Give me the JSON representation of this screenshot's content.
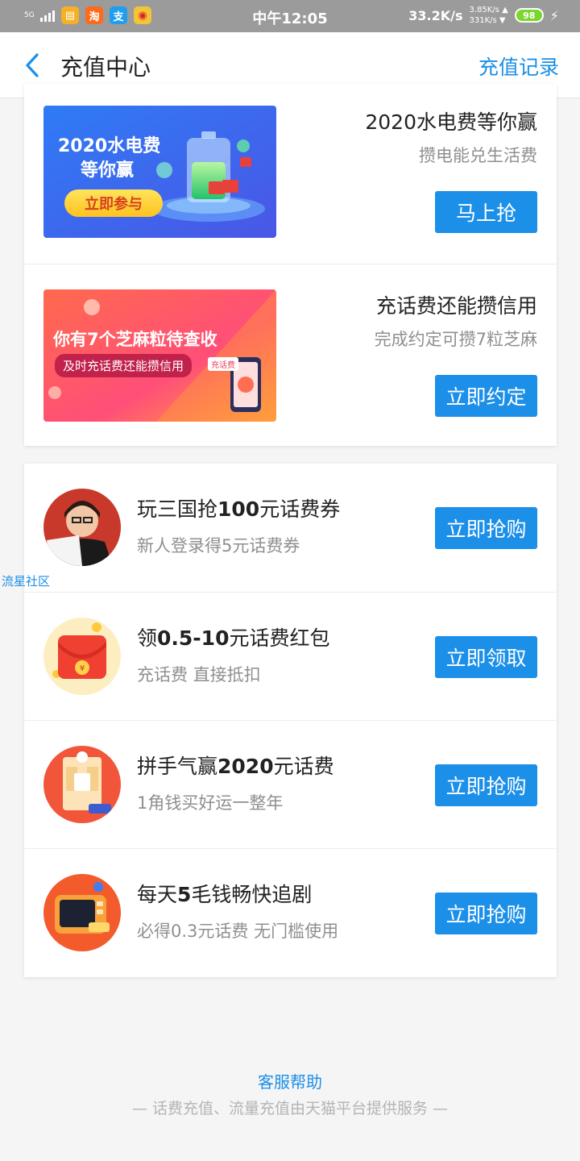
{
  "status_bar": {
    "signal": "5G",
    "time": "中午12:05",
    "net_speed": "33.2K/s",
    "up_speed": "3.85K/s ▲",
    "down_speed": "331K/s ▼",
    "battery": "98"
  },
  "header": {
    "title": "充值中心",
    "history_label": "充值记录"
  },
  "promos": [
    {
      "title": "2020水电费等你赢",
      "subtitle": "攒电能兑生活费",
      "button": "马上抢",
      "banner_line1": "2020水电费",
      "banner_line2": "等你赢",
      "banner_cta": "立即参与"
    },
    {
      "title": "充话费还能攒信用",
      "subtitle": "完成约定可攒7粒芝麻",
      "button": "立即约定",
      "banner_line1": "你有7个芝麻粒待查收",
      "banner_line2": "及时充话费还能攒信用",
      "banner_tag": "充话费"
    }
  ],
  "offers": [
    {
      "title_a": "玩三国抢",
      "title_b": "100",
      "title_c": "元话费券",
      "subtitle": "新人登录得5元话费券",
      "button": "立即抢购"
    },
    {
      "title_a": "领",
      "title_b": "0.5-10",
      "title_c": "元话费红包",
      "subtitle": "充话费 直接抵扣",
      "button": "立即领取"
    },
    {
      "title_a": "拼手气赢",
      "title_b": "2020",
      "title_c": "元话费",
      "subtitle": "1角钱买好运一整年",
      "button": "立即抢购"
    },
    {
      "title_a": "每天",
      "title_b": "5",
      "title_c": "毛钱畅快追剧",
      "subtitle": "必得0.3元话费 无门槛使用",
      "button": "立即抢购"
    }
  ],
  "watermark": "流星社区",
  "footer": {
    "help_label": "客服帮助",
    "note": "— 话费充值、流量充值由天猫平台提供服务 —"
  }
}
